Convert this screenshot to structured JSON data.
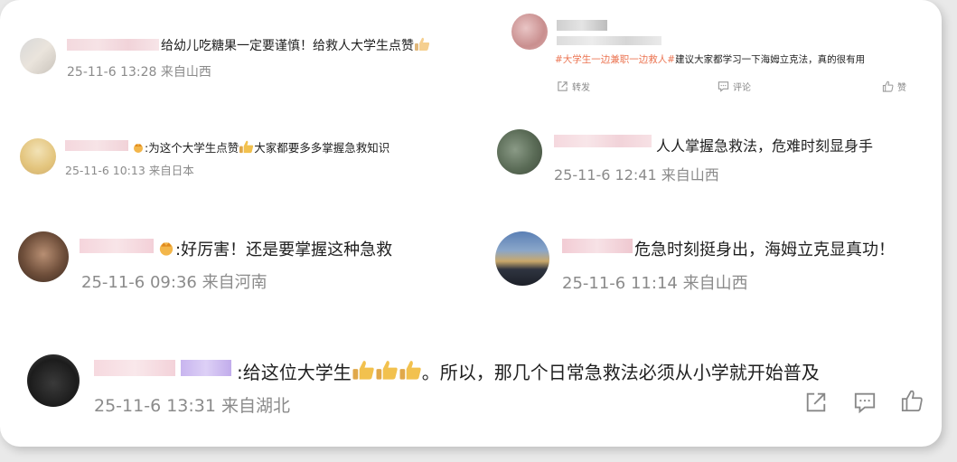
{
  "comments": [
    {
      "text": "给幼儿吃糖果一定要谨慎！给救人大学生点赞",
      "meta": "25-11-6 13:28 来自山西"
    },
    {
      "hashtag": "#大学生一边兼职一边救人#",
      "text": "建议大家都学习一下海姆立克法，真的很有用",
      "actions": {
        "share": "转发",
        "comment": "评论",
        "like": "赞"
      }
    },
    {
      "text": ":为这个大学生点赞",
      "text2": "大家都要多多掌握急救知识",
      "meta": "25-11-6 10:13 来自日本"
    },
    {
      "text": "人人掌握急救法，危难时刻显身手",
      "meta": "25-11-6 12:41 来自山西"
    },
    {
      "text": ":好厉害！还是要掌握这种急救",
      "meta": "25-11-6 09:36 来自河南"
    },
    {
      "text": "危急时刻挺身出，海姆立克显真功！",
      "meta": "25-11-6 11:14 来自山西"
    },
    {
      "text": ":给这位大学生",
      "text2": "。所以，那几个日常急救法必须从小学就开始普及",
      "meta": "25-11-6 13:31 来自湖北"
    }
  ],
  "colors": {
    "hashtag": "#eb7350",
    "meta": "#8b8b8b",
    "icon": "#888888"
  }
}
